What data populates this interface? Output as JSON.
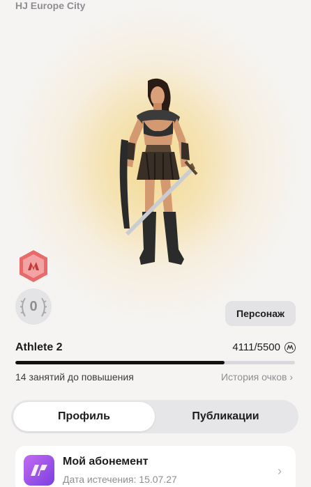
{
  "header": {
    "club_name": "HJ Europe City"
  },
  "character": {
    "icon": "warrior-character"
  },
  "badges": {
    "rank_icon": "rank-hexagon-icon",
    "rank_color": "#e85a5a",
    "achievements_count": "0"
  },
  "persona_button": {
    "label": "Персонаж"
  },
  "level": {
    "name": "Athlete 2",
    "points": "4111/5500",
    "progress_fraction": 0.7475,
    "sessions_left": "14 занятий до повышения",
    "history_link": "История очков",
    "history_chevron": "›"
  },
  "tabs": [
    {
      "label": "Профиль",
      "active": true
    },
    {
      "label": "Публикации",
      "active": false
    }
  ],
  "subscription_card": {
    "title": "Мой абонемент",
    "subtitle": "Дата истечения: 15.07.27",
    "chevron": "›"
  },
  "colors": {
    "accent": "#7b3fe0",
    "progress": "#111111",
    "background": "#f5f4f2"
  }
}
